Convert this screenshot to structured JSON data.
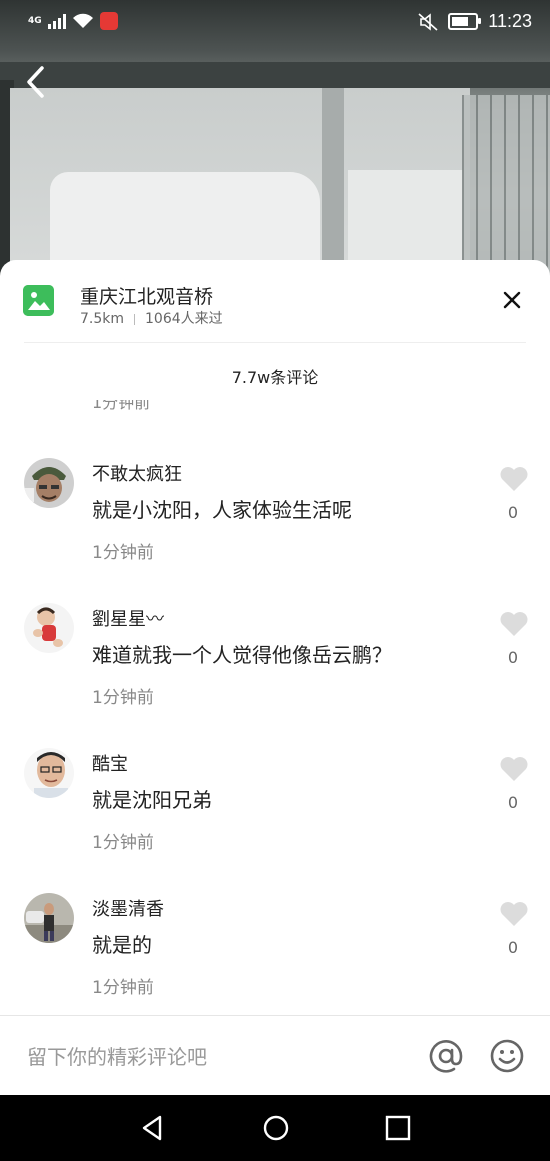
{
  "status_bar": {
    "network": "4G",
    "time": "11:23"
  },
  "location": {
    "title": "重庆江北观音桥",
    "distance": "7.5km",
    "visitors": "1064人来过"
  },
  "comments_header": {
    "count": "7.7w条评论",
    "partial_time": "1分钟前"
  },
  "comments": [
    {
      "user": "不敢太疯狂",
      "text": "就是小沈阳，人家体验生活呢",
      "time": "1分钟前",
      "likes": "0"
    },
    {
      "user": "劉星星〰",
      "text": "难道就我一个人觉得他像岳云鹏？",
      "time": "1分钟前",
      "likes": "0"
    },
    {
      "user": "酷宝",
      "text": "就是沈阳兄弟",
      "time": "1分钟前",
      "likes": "0"
    },
    {
      "user": "淡墨清香",
      "text": "就是的",
      "time": "1分钟前",
      "likes": "0"
    }
  ],
  "input": {
    "placeholder": "留下你的精彩评论吧",
    "value": ""
  },
  "icons": {
    "back": "chevron-left-icon",
    "location": "image-icon",
    "close": "close-icon",
    "like": "heart-icon",
    "at": "at-icon",
    "emoji": "emoji-icon"
  },
  "colors": {
    "accent_green": "#3dbd5b",
    "like_grey": "#dcdcdc",
    "text_primary": "#222222",
    "text_secondary": "#888888"
  }
}
